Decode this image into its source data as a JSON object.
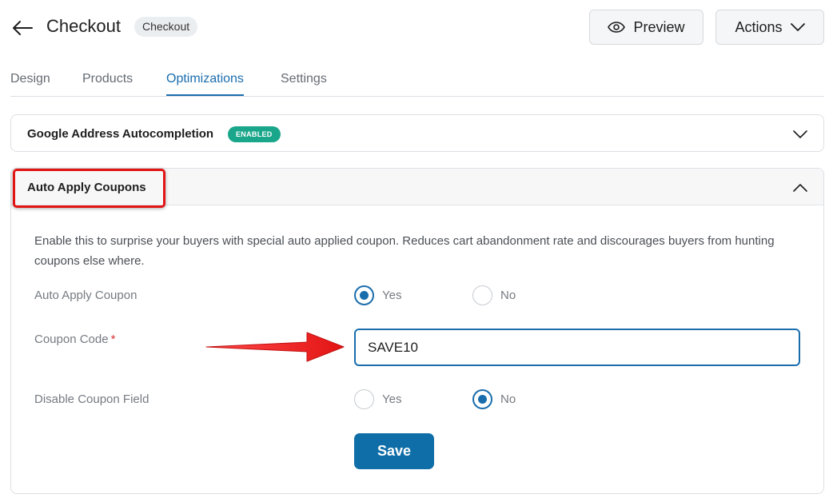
{
  "header": {
    "title": "Checkout",
    "badge": "Checkout",
    "preview_label": "Preview",
    "actions_label": "Actions"
  },
  "tabs": [
    {
      "label": "Design"
    },
    {
      "label": "Products"
    },
    {
      "label": "Optimizations"
    },
    {
      "label": "Settings"
    }
  ],
  "active_tab": "Optimizations",
  "panels": [
    {
      "title": "Google Address Autocompletion",
      "badge": "ENABLED",
      "expanded": false
    },
    {
      "title": "Auto Apply Coupons",
      "expanded": true
    }
  ],
  "auto_apply": {
    "description": "Enable this to surprise your buyers with special auto applied coupon. Reduces cart abandonment rate and discourages buyers from hunting coupons else where.",
    "auto_apply_label": "Auto Apply Coupon",
    "auto_apply_options": {
      "yes": "Yes",
      "no": "No"
    },
    "auto_apply_selected": "Yes",
    "coupon_label": "Coupon Code",
    "coupon_required_mark": "*",
    "coupon_value": "SAVE10",
    "disable_label": "Disable Coupon Field",
    "disable_options": {
      "yes": "Yes",
      "no": "No"
    },
    "disable_selected": "No",
    "save_label": "Save"
  },
  "colors": {
    "accent": "#1a6dad",
    "save_button": "#0f6ea8",
    "enabled_badge": "#1aa68a",
    "annotation_red": "#e31414"
  },
  "icons": [
    "arrow-left-icon",
    "eye-icon",
    "chevron-down-icon",
    "chevron-up-icon"
  ]
}
